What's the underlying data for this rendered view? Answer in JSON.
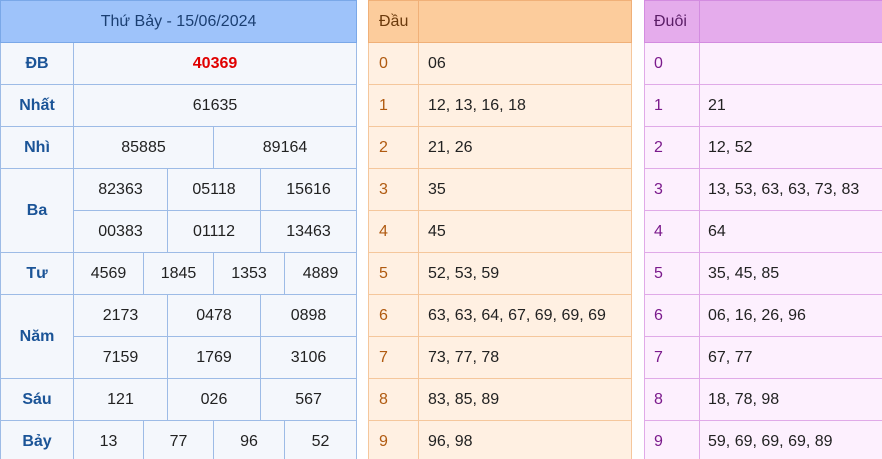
{
  "results": {
    "date_title": "Thứ Bảy - 15/06/2024",
    "db": {
      "label": "ĐB",
      "value": "40369"
    },
    "nhat": {
      "label": "Nhất",
      "value": "61635"
    },
    "nhi": {
      "label": "Nhì",
      "values": [
        "85885",
        "89164"
      ]
    },
    "ba": {
      "label": "Ba",
      "values": [
        "82363",
        "05118",
        "15616",
        "00383",
        "01112",
        "13463"
      ]
    },
    "tu": {
      "label": "Tư",
      "values": [
        "4569",
        "1845",
        "1353",
        "4889"
      ]
    },
    "nam": {
      "label": "Năm",
      "values": [
        "2173",
        "0478",
        "0898",
        "7159",
        "1769",
        "3106"
      ]
    },
    "sau": {
      "label": "Sáu",
      "values": [
        "121",
        "026",
        "567"
      ]
    },
    "bay": {
      "label": "Bảy",
      "values": [
        "13",
        "77",
        "96",
        "52"
      ]
    }
  },
  "dau": {
    "header": "Đầu",
    "rows": [
      {
        "digit": "0",
        "values": "06"
      },
      {
        "digit": "1",
        "values": "12, 13, 16, 18"
      },
      {
        "digit": "2",
        "values": "21, 26"
      },
      {
        "digit": "3",
        "values": "35"
      },
      {
        "digit": "4",
        "values": "45"
      },
      {
        "digit": "5",
        "values": "52, 53, 59"
      },
      {
        "digit": "6",
        "values": "63, 63, 64, 67, 69, 69, 69"
      },
      {
        "digit": "7",
        "values": "73, 77, 78"
      },
      {
        "digit": "8",
        "values": "83, 85, 89"
      },
      {
        "digit": "9",
        "values": "96, 98"
      }
    ]
  },
  "duoi": {
    "header": "Đuôi",
    "rows": [
      {
        "digit": "0",
        "values": ""
      },
      {
        "digit": "1",
        "values": "21"
      },
      {
        "digit": "2",
        "values": "12, 52"
      },
      {
        "digit": "3",
        "values": "13, 53, 63, 63, 73, 83"
      },
      {
        "digit": "4",
        "values": "64"
      },
      {
        "digit": "5",
        "values": "35, 45, 85"
      },
      {
        "digit": "6",
        "values": "06, 16, 26, 96"
      },
      {
        "digit": "7",
        "values": "67, 77"
      },
      {
        "digit": "8",
        "values": "18, 78, 98"
      },
      {
        "digit": "9",
        "values": "59, 69, 69, 69, 89"
      }
    ]
  }
}
